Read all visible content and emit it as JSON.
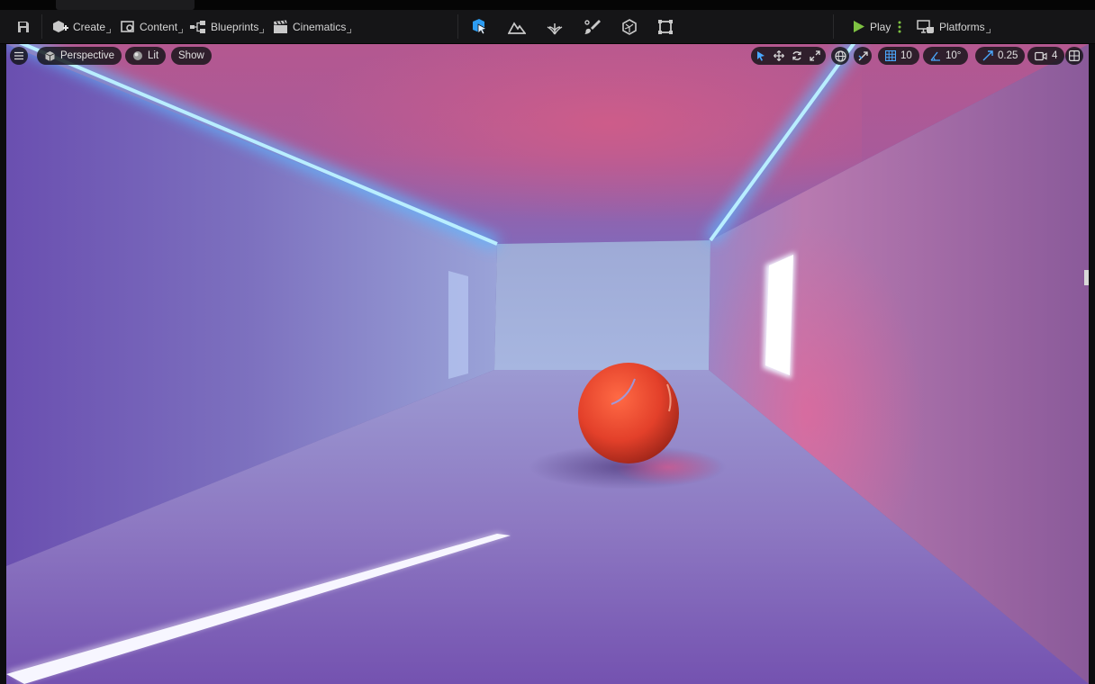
{
  "window": {
    "tab_title": ""
  },
  "toolbar": {
    "left_items": [
      {
        "name": "create",
        "label": "Create",
        "icon": "cube-add-icon"
      },
      {
        "name": "content",
        "label": "Content",
        "icon": "content-drawer-icon"
      },
      {
        "name": "blueprints",
        "label": "Blueprints",
        "icon": "blueprint-node-icon"
      },
      {
        "name": "cinematics",
        "label": "Cinematics",
        "icon": "clapperboard-icon"
      }
    ],
    "modes": [
      "select-mode-icon",
      "landscape-mode-icon",
      "foliage-mode-icon",
      "paint-mode-icon",
      "fracture-mode-icon",
      "modeling-mode-icon"
    ],
    "play_label": "Play",
    "platforms_label": "Platforms",
    "accent_play": "#7ec242",
    "accent_mode": "#2c9cf2"
  },
  "viewport": {
    "menu_icon": "hamburger-icon",
    "view_mode": "Perspective",
    "lighting_mode": "Lit",
    "show_label": "Show",
    "grid_snap": "10",
    "rotation_snap": "10°",
    "scale_snap": "0.25",
    "camera_speed": "4",
    "transform_tools": [
      "select-arrow-icon",
      "translate-icon",
      "rotate-icon",
      "scale-icon"
    ],
    "colors": {
      "neon_strip": "#7fd7ff",
      "wall_tint": "#7c6cc4",
      "ceiling_tint": "#c75a8c",
      "sphere": "#e3402a"
    }
  }
}
